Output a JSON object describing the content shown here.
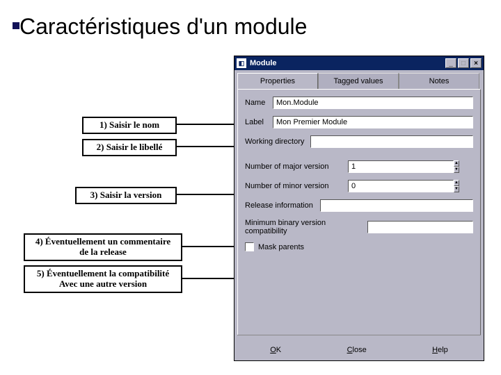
{
  "slide": {
    "title": "Caractéristiques d'un module"
  },
  "annot": {
    "a1": "1) Saisir le nom",
    "a2": "2) Saisir le libellé",
    "a3": "3) Saisir la version",
    "a4": "4) Éventuellement un commentaire\nde la release",
    "a5": "5) Éventuellement la compatibilité\nAvec une autre version"
  },
  "win": {
    "title": "Module",
    "tabs": {
      "properties": "Properties",
      "tagged": "Tagged values",
      "notes": "Notes"
    },
    "fields": {
      "name_label": "Name",
      "name_value": "Mon.Module",
      "label_label": "Label",
      "label_value": "Mon Premier Module",
      "workdir_label": "Working directory",
      "workdir_value": "",
      "major_label": "Number of major version",
      "major_value": "1",
      "minor_label": "Number of minor version",
      "minor_value": "0",
      "release_label": "Release information",
      "release_value": "",
      "compat_label": "Minimum binary version compatibility",
      "compat_value": "",
      "mask_label": "Mask parents"
    },
    "buttons": {
      "ok": "OK",
      "close": "Close",
      "help": "Help"
    }
  }
}
